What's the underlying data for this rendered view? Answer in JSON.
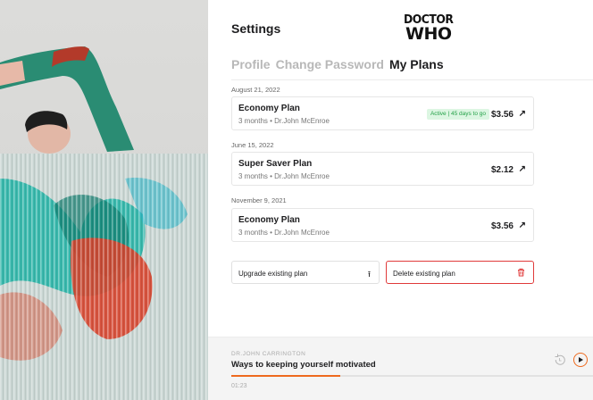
{
  "header": {
    "title": "Settings",
    "logo_line1": "DOCTOR",
    "logo_line2": "WHO"
  },
  "tabs": [
    {
      "label": "Profile",
      "active": false
    },
    {
      "label": "Change Password",
      "active": false
    },
    {
      "label": "My Plans",
      "active": true
    }
  ],
  "plans": [
    {
      "date": "August 21, 2022",
      "name": "Economy Plan",
      "meta": "3 months • Dr.John McEnroe",
      "price": "$3.56",
      "badge": "Active | 45 days to go"
    },
    {
      "date": "June 15, 2022",
      "name": "Super Saver Plan",
      "meta": "3 months • Dr.John McEnroe",
      "price": "$2.12",
      "badge": ""
    },
    {
      "date": "November 9, 2021",
      "name": "Economy Plan",
      "meta": "3 months • Dr.John McEnroe",
      "price": "$3.56",
      "badge": ""
    }
  ],
  "actions": {
    "upgrade_label": "Upgrade existing plan",
    "delete_label": "Delete existing plan"
  },
  "player": {
    "author": "DR.JOHN CARRINGTON",
    "track": "Ways to keeping yourself motivated",
    "time": "01:23",
    "progress": 0.3
  },
  "colors": {
    "accent": "#ee6a1e",
    "danger": "#e03a3a",
    "success": "#24a148",
    "success_bg": "#dcf6e2"
  },
  "icons": {
    "arrow": "arrow-up-right-icon",
    "upgrade": "upload-icon",
    "delete": "trash-icon",
    "replay": "replay-icon",
    "play": "play-icon"
  }
}
